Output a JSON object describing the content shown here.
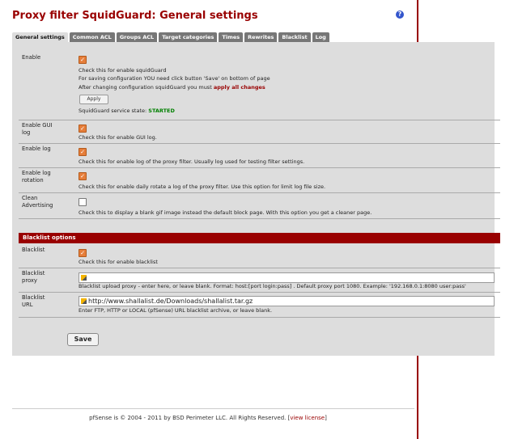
{
  "title": "Proxy filter SquidGuard: General settings",
  "tabs": [
    {
      "label": "General settings",
      "active": true
    },
    {
      "label": "Common ACL",
      "active": false
    },
    {
      "label": "Groups ACL",
      "active": false
    },
    {
      "label": "Target categories",
      "active": false
    },
    {
      "label": "Times",
      "active": false
    },
    {
      "label": "Rewrites",
      "active": false
    },
    {
      "label": "Blacklist",
      "active": false
    },
    {
      "label": "Log",
      "active": false
    }
  ],
  "rows": {
    "enable": {
      "label": "Enable",
      "checked": true,
      "desc": "Check this for enable squidGuard",
      "note1": "For saving configuration YOU need click button 'Save' on bottom of page",
      "note2_prefix": "After changing configuration squidGuard you must ",
      "note2_link": "apply all changes",
      "apply_label": "Apply",
      "status_prefix": "SquidGuard service state: ",
      "status_value": "STARTED"
    },
    "gui_log": {
      "label_line1": "Enable GUI",
      "label_line2": "log",
      "checked": true,
      "desc": "Check this for enable GUI log."
    },
    "log": {
      "label": "Enable log",
      "checked": true,
      "desc": "Check this for enable log of the proxy filter. Usually log used for testing filter settings."
    },
    "log_rotation": {
      "label_line1": "Enable log",
      "label_line2": "rotation",
      "checked": true,
      "desc": "Check this for enable daily rotate a log of the proxy filter. Use this option for limit log file size."
    },
    "clean_adv": {
      "label_line1": "Clean",
      "label_line2": "Advertising",
      "checked": false,
      "desc": "Check this to display a blank gif image instead the default block page. With this option you get a cleaner page."
    }
  },
  "blacklist_section": {
    "header": "Blacklist options",
    "blacklist": {
      "label": "Blacklist",
      "checked": true,
      "desc": "Check this for enable blacklist"
    },
    "proxy": {
      "label_line1": "Blacklist",
      "label_line2": "proxy",
      "value": "",
      "desc": "Blacklist upload proxy - enter here, or leave blank. Format: host:[port login:pass] . Default proxy port 1080. Example: '192.168.0.1:8080 user:pass'"
    },
    "url": {
      "label_line1": "Blacklist",
      "label_line2": "URL",
      "value": "http://www.shallalist.de/Downloads/shallalist.tar.gz",
      "desc": "Enter FTP, HTTP or LOCAL (pfSense) URL blacklist archive, or leave blank."
    }
  },
  "save_label": "Save",
  "footer": {
    "text": "pfSense is © 2004 - 2011 by BSD Perimeter LLC. All Rights Reserved. [",
    "link": "view license",
    "close": "]"
  },
  "colors": {
    "brand": "#990000",
    "panel": "#dddddd",
    "status": "#008000",
    "checkbox": "#e67e3a"
  }
}
